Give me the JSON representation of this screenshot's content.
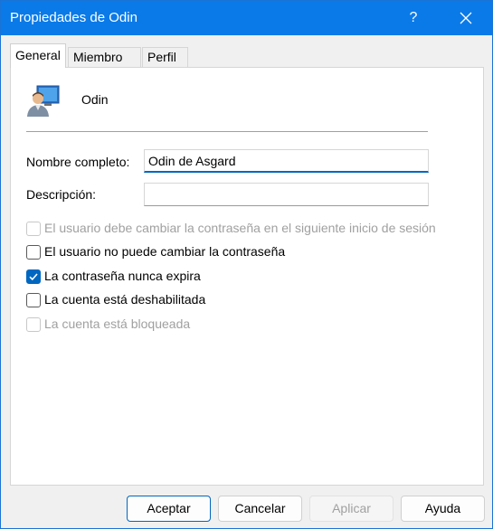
{
  "window": {
    "title": "Propiedades de Odin",
    "help_label": "?",
    "accent": "#0a7ae8"
  },
  "tabs": [
    {
      "label": "General",
      "active": true
    },
    {
      "label": "Miembro de",
      "active": false
    },
    {
      "label": "Perfil",
      "active": false
    }
  ],
  "user": {
    "name": "Odin",
    "icon": "user-account-icon"
  },
  "form": {
    "full_name_label": "Nombre completo:",
    "full_name_value": "Odin de Asgard",
    "description_label": "Descripción:",
    "description_value": ""
  },
  "checkboxes": [
    {
      "label": "El usuario debe cambiar la contraseña en el siguiente inicio de sesión",
      "checked": false,
      "disabled": true
    },
    {
      "label": "El usuario no puede cambiar la contraseña",
      "checked": false,
      "disabled": false
    },
    {
      "label": "La contraseña nunca expira",
      "checked": true,
      "disabled": false
    },
    {
      "label": "La cuenta está deshabilitada",
      "checked": false,
      "disabled": false
    },
    {
      "label": "La cuenta está bloqueada",
      "checked": false,
      "disabled": true
    }
  ],
  "buttons": {
    "ok": "Aceptar",
    "cancel": "Cancelar",
    "apply": "Aplicar",
    "help": "Ayuda"
  }
}
